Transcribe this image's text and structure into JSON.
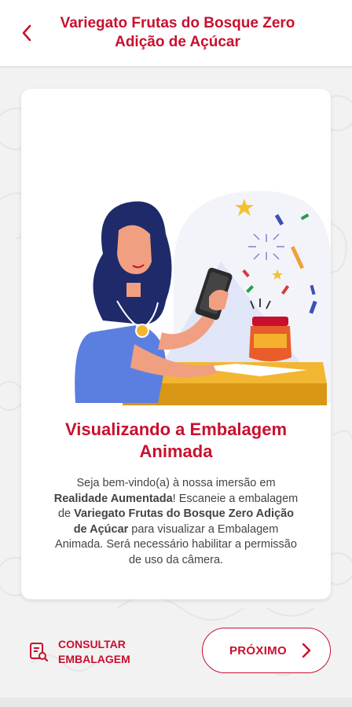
{
  "header": {
    "title": "Variegato Frutas do Bosque Zero Adição de Açúcar",
    "back_icon": "chevron-left-icon"
  },
  "card": {
    "title": "Visualizando a Embalagem Animada",
    "body_parts": [
      "Seja bem-vindo(a) à nossa imersão em ",
      "Realidade Aumentada",
      "! Escaneie a embalagem de ",
      "Variegato Frutas do Bosque Zero Adição de Açúcar",
      " para visualizar a Embalagem Animada. Será necessário habilitar a permissão de uso da câmera."
    ]
  },
  "footer": {
    "consult_label": "CONSULTAR\nEMBALAGEM",
    "consult_icon": "document-search-icon",
    "next_label": "PRÓXIMO",
    "next_icon": "chevron-right-icon"
  },
  "colors": {
    "brand_red": "#c8102e",
    "background": "#f2f2f2",
    "card": "#ffffff"
  }
}
